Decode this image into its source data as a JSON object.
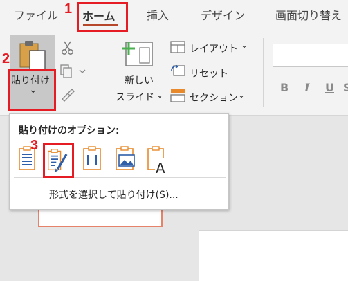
{
  "tabs": {
    "file": "ファイル",
    "home": "ホーム",
    "insert": "挿入",
    "design": "デザイン",
    "transitions": "画面切り替え"
  },
  "ribbon": {
    "paste_label": "貼り付け",
    "paste_chevron": "⌄",
    "new_slide_line1": "新しい",
    "new_slide_line2": "スライド",
    "layout": "レイアウト",
    "reset": "リセット",
    "section": "セクション",
    "bold": "B",
    "italic": "I",
    "underline": "U",
    "strikethrough": "S"
  },
  "paste_menu": {
    "title": "貼り付けのオプション:",
    "options": [
      "use-destination-theme",
      "keep-source-formatting",
      "embed",
      "picture",
      "keep-text-only"
    ],
    "paste_special_prefix": "形式を選択して貼り付け(",
    "paste_special_key": "S",
    "paste_special_suffix": ")..."
  },
  "callouts": [
    "1",
    "2",
    "3"
  ],
  "colors": {
    "callout_red": "#e51c23",
    "accent_orange": "#b7472a",
    "icon_blue": "#2f5fa8",
    "icon_orange": "#e88a2c"
  }
}
